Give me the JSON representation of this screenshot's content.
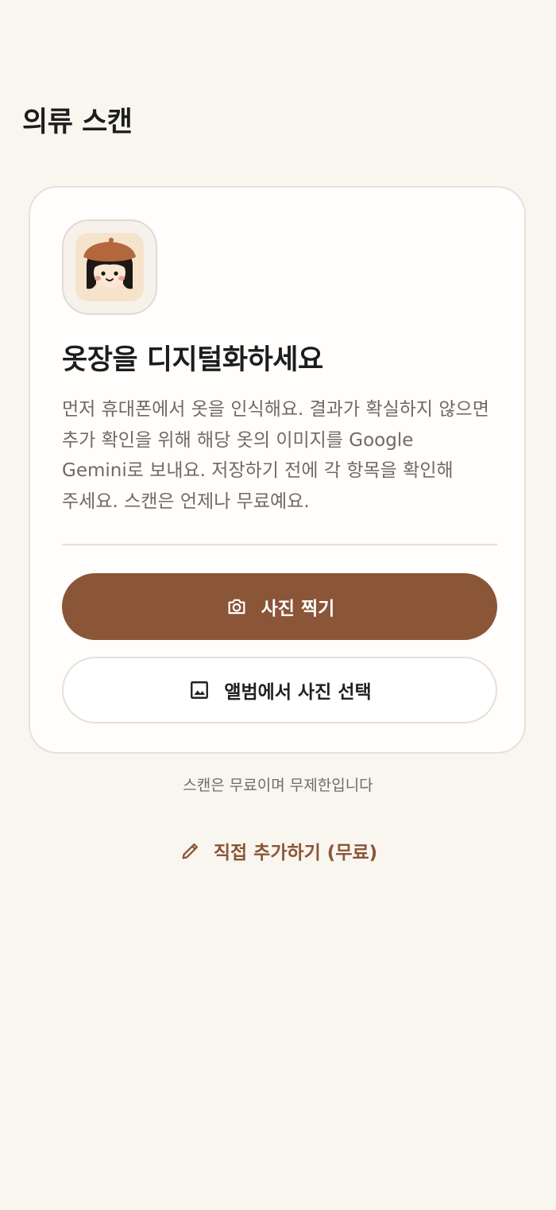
{
  "header": {
    "title": "의류 스캔"
  },
  "card": {
    "avatar_icon": "mascot-beret-girl-icon",
    "heading": "옷장을 디지털화하세요",
    "description": "먼저 휴대폰에서 옷을 인식해요. 결과가 확실하지 않으면 추가 확인을 위해 해당 옷의 이미지를 Google Gemini로 보내요. 저장하기 전에 각 항목을 확인해 주세요. 스캔은 언제나 무료예요.",
    "take_photo": {
      "label": "사진 찍기",
      "icon": "camera-icon"
    },
    "choose_album": {
      "label": "앨범에서 사진 선택",
      "icon": "image-icon"
    }
  },
  "footnote": "스캔은 무료이며 무제한입니다",
  "manual_add": {
    "label": "직접 추가하기 (무료)",
    "icon": "pencil-icon"
  },
  "colors": {
    "background": "#f9f6f0",
    "accent": "#8b5538",
    "card": "#fffefc",
    "border": "#e4e0db",
    "muted_text": "#6f6a65"
  }
}
